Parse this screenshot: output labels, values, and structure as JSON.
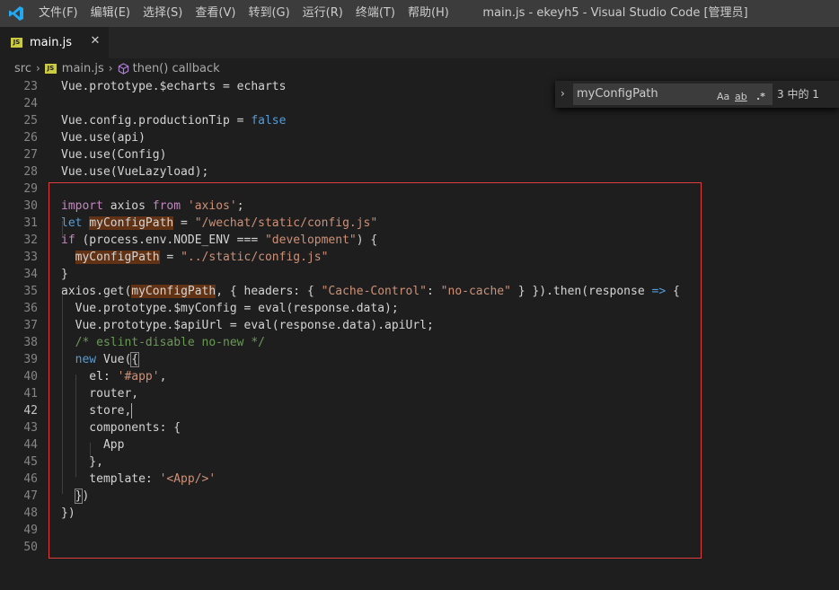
{
  "titlebar": {
    "menu": [
      "文件(F)",
      "编辑(E)",
      "选择(S)",
      "查看(V)",
      "转到(G)",
      "运行(R)",
      "终端(T)",
      "帮助(H)"
    ],
    "window_title": "main.js - ekeyh5 - Visual Studio Code [管理员]"
  },
  "tab": {
    "js_label": "JS",
    "label": "main.js",
    "close": "✕"
  },
  "breadcrumb": {
    "folder": "src",
    "file": "main.js",
    "method": "then() callback",
    "sep": "›"
  },
  "find": {
    "toggle": "›",
    "query": "myConfigPath",
    "match_case": "Aa",
    "whole_word": "ab",
    "regex": ".*",
    "count": "3 中的 1"
  },
  "editor": {
    "active_line": 42,
    "lines": [
      {
        "n": "23",
        "text": "Vue.prototype.$echarts = echarts"
      },
      {
        "n": "24",
        "text": ""
      },
      {
        "n": "25",
        "text": "Vue.config.productionTip = false"
      },
      {
        "n": "26",
        "text": "Vue.use(api)"
      },
      {
        "n": "27",
        "text": "Vue.use(Config)"
      },
      {
        "n": "28",
        "text": "Vue.use(VueLazyload);"
      },
      {
        "n": "29",
        "text": ""
      },
      {
        "n": "30",
        "text": "import axios from 'axios';"
      },
      {
        "n": "31",
        "text": "let myConfigPath = \"/wechat/static/config.js\""
      },
      {
        "n": "32",
        "text": "if (process.env.NODE_ENV === \"development\") {"
      },
      {
        "n": "33",
        "text": "  myConfigPath = \"../static/config.js\""
      },
      {
        "n": "34",
        "text": "}"
      },
      {
        "n": "35",
        "text": "axios.get(myConfigPath, { headers: { \"Cache-Control\": \"no-cache\" } }).then(response => {"
      },
      {
        "n": "36",
        "text": "  Vue.prototype.$myConfig = eval(response.data);"
      },
      {
        "n": "37",
        "text": "  Vue.prototype.$apiUrl = eval(response.data).apiUrl;"
      },
      {
        "n": "38",
        "text": "  /* eslint-disable no-new */"
      },
      {
        "n": "39",
        "text": "  new Vue({"
      },
      {
        "n": "40",
        "text": "    el: '#app',"
      },
      {
        "n": "41",
        "text": "    router,"
      },
      {
        "n": "42",
        "text": "    store,"
      },
      {
        "n": "43",
        "text": "    components: {"
      },
      {
        "n": "44",
        "text": "      App"
      },
      {
        "n": "45",
        "text": "    },"
      },
      {
        "n": "46",
        "text": "    template: '<App/>'"
      },
      {
        "n": "47",
        "text": "  })"
      },
      {
        "n": "48",
        "text": "})"
      },
      {
        "n": "49",
        "text": ""
      },
      {
        "n": "50",
        "text": ""
      }
    ]
  }
}
